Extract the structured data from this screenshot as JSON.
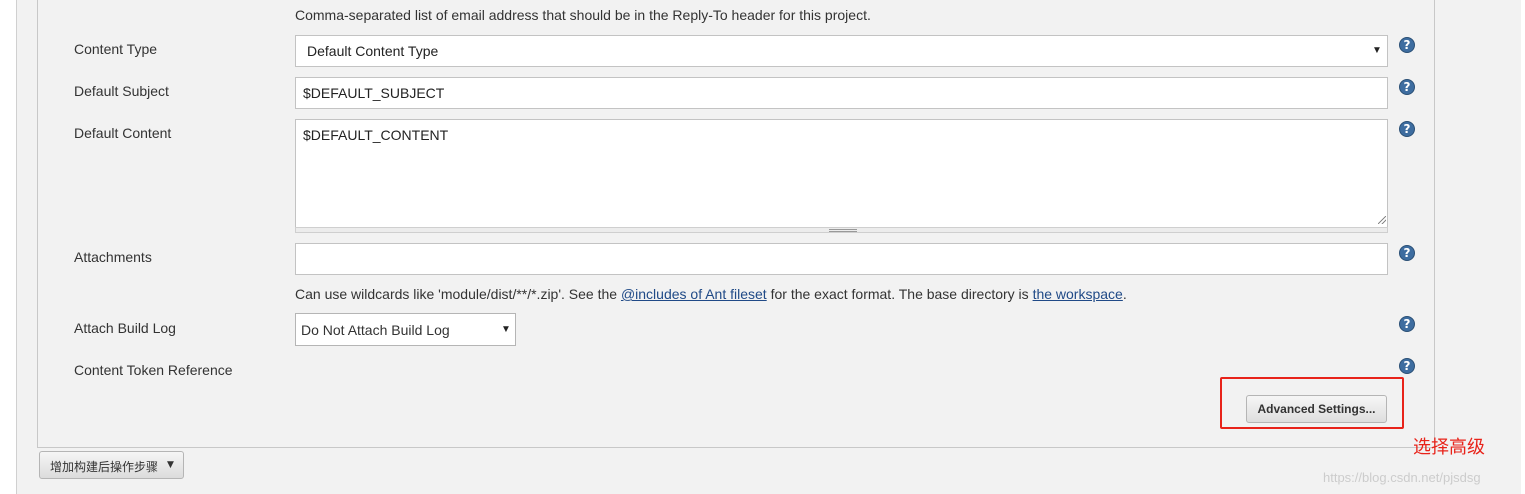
{
  "reply_to": {
    "description": "Comma-separated list of email address that should be in the Reply-To header for this project."
  },
  "content_type": {
    "label": "Content Type",
    "value": "Default Content Type",
    "help_icon": "question-mark"
  },
  "default_subject": {
    "label": "Default Subject",
    "value": "$DEFAULT_SUBJECT",
    "help_icon": "question-mark"
  },
  "default_content": {
    "label": "Default Content",
    "value": "$DEFAULT_CONTENT",
    "help_icon": "question-mark"
  },
  "attachments": {
    "label": "Attachments",
    "value": "",
    "help_text_prefix": "Can use wildcards like 'module/dist/**/*.zip'. See the ",
    "link_ant": "@includes of Ant fileset",
    "help_text_mid": " for the exact format. The base directory is ",
    "link_workspace": "the workspace",
    "help_text_suffix": ".",
    "help_icon": "question-mark"
  },
  "attach_build_log": {
    "label": "Attach Build Log",
    "value": "Do Not Attach Build Log",
    "help_icon": "question-mark"
  },
  "content_token_reference": {
    "label": "Content Token Reference",
    "help_icon": "question-mark"
  },
  "advanced_button": {
    "label": "Advanced Settings..."
  },
  "annotation": {
    "text": "选择高级",
    "color": "#e8231a"
  },
  "add_post_build_step": {
    "label": "增加构建后操作步骤"
  },
  "watermark": {
    "text": "https://blog.csdn.net/pjsdsg"
  },
  "icons": {
    "help": "?",
    "select_arrow": "▼"
  },
  "colors": {
    "panel_bg": "#f2f2f2",
    "link": "#204a87",
    "help_icon": "#3e6da0",
    "highlight": "#e8231a"
  }
}
